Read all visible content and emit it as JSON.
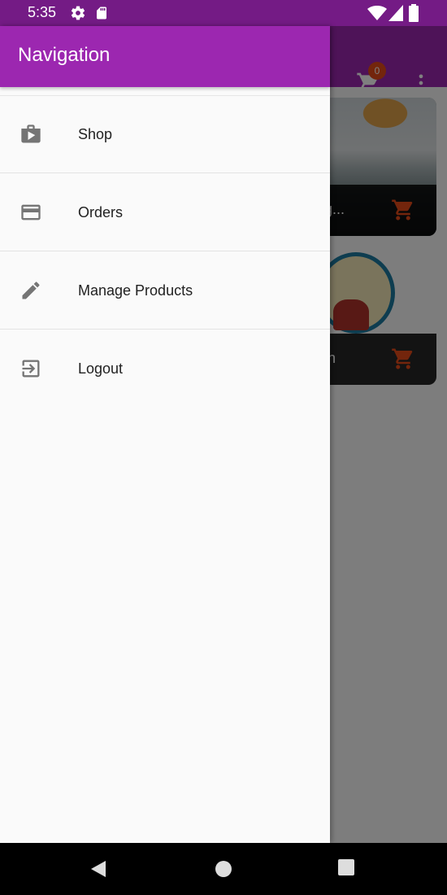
{
  "status_bar": {
    "time": "5:35",
    "icons": [
      "settings-icon",
      "sd-card-icon",
      "wifi-icon",
      "signal-icon",
      "battery-icon"
    ]
  },
  "app_bar": {
    "cart_badge": "0",
    "icons": [
      "cart-icon",
      "more-vert-icon"
    ]
  },
  "products": [
    {
      "title": "ing..."
    },
    {
      "title": "fish"
    }
  ],
  "drawer": {
    "title": "Navigation",
    "items": [
      {
        "label": "Shop",
        "icon": "shop-icon"
      },
      {
        "label": "Orders",
        "icon": "credit-card-icon"
      },
      {
        "label": "Manage Products",
        "icon": "edit-icon"
      },
      {
        "label": "Logout",
        "icon": "logout-icon"
      }
    ]
  },
  "colors": {
    "primary": "#9c27b0",
    "status_bar": "#741b85",
    "accent": "#e64a19"
  },
  "nav_bar": {
    "buttons": [
      "back-icon",
      "home-icon",
      "recents-icon"
    ]
  }
}
